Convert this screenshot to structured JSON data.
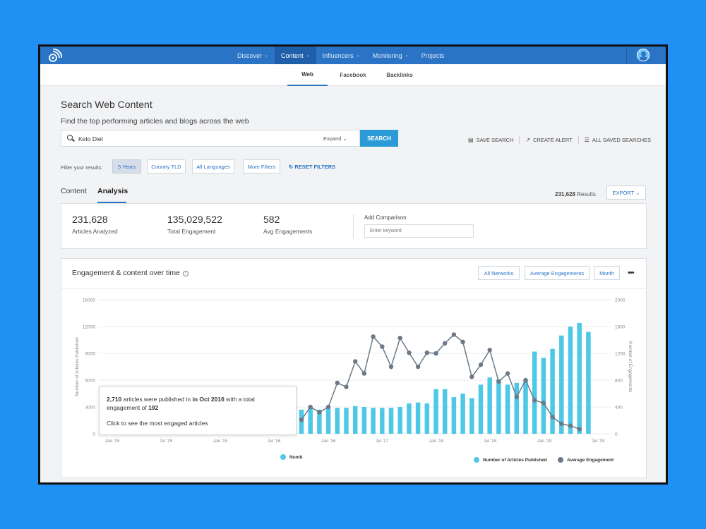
{
  "nav": {
    "items": [
      {
        "label": "Discover",
        "chev": true,
        "active": false
      },
      {
        "label": "Content",
        "chev": true,
        "active": true
      },
      {
        "label": "Influencers",
        "chev": true,
        "active": false
      },
      {
        "label": "Monitoring",
        "chev": true,
        "active": false
      },
      {
        "label": "Projects",
        "chev": false,
        "active": false
      }
    ]
  },
  "subnav": {
    "web": "Web",
    "facebook": "Facebook",
    "backlinks": "Backlinks"
  },
  "page": {
    "title": "Search Web Content",
    "subtitle": "Find the top performing articles and blogs across the web"
  },
  "search": {
    "value": "Keto Diet",
    "expand": "Expand",
    "button": "SEARCH",
    "save": "SAVE SEARCH",
    "alert": "CREATE ALERT",
    "saved": "ALL SAVED SEARCHES"
  },
  "filters": {
    "label": "Filter your results:",
    "years": "5 Years",
    "tld": "Country TLD",
    "languages": "All Languages",
    "more": "More Filters",
    "reset": "RESET FILTERS"
  },
  "tabs": {
    "content": "Content",
    "analysis": "Analysis"
  },
  "results": {
    "count": "231,628",
    "label": "Results",
    "export": "EXPORT"
  },
  "stats": {
    "articles_value": "231,628",
    "articles_label": "Articles Analyzed",
    "engagement_value": "135,029,522",
    "engagement_label": "Total Engagement",
    "avg_value": "582",
    "avg_label": "Avg Engagements",
    "compare_label": "Add Comparison",
    "compare_placeholder": "Enter keyword"
  },
  "chart_card": {
    "title": "Engagement & content over time",
    "networks": "All Networks",
    "metric": "Average Engagements",
    "period": "Month",
    "more": "•••"
  },
  "tooltip": {
    "count": "2,710",
    "text1": " articles were published in ",
    "month": "in Oct 2016",
    "text2": " with a total engagement of ",
    "engagement": "192",
    "cta": "Click to see the most engaged articles"
  },
  "legend": {
    "partial": "Numb",
    "articles": "Number of Articles Published",
    "engagement": "Average Engagement"
  },
  "colors": {
    "bar": "#4fc8e6",
    "line": "#6b7885",
    "accent": "#2b74c5",
    "button": "#2b9bd8"
  },
  "chart_data": {
    "type": "bar",
    "x_ticks": [
      "Jan '15",
      "Jul '15",
      "Jan '15",
      "Jul '16",
      "Jan '16",
      "Jul '17",
      "Jan '18",
      "Jul '18",
      "Jan '19",
      "Jul '19"
    ],
    "ylabel": "Number of Articles Published",
    "ylabel_right": "Number of Engagements",
    "ylim": [
      0,
      15000
    ],
    "ylim_right": [
      0,
      2000
    ],
    "yticks": [
      "0",
      "3000",
      "6000",
      "9000",
      "12000",
      "15000"
    ],
    "yticks_right": [
      "0",
      "400",
      "800",
      "1200",
      "1600",
      "2000"
    ],
    "series": [
      {
        "name": "Number of Articles Published",
        "type": "bar",
        "values": [
          2700,
          2900,
          2700,
          2800,
          2900,
          2900,
          3100,
          3000,
          2900,
          2900,
          2900,
          3000,
          3400,
          3500,
          3400,
          5000,
          5000,
          4100,
          4500,
          4000,
          5500,
          6300,
          6100,
          5500,
          5700,
          6000,
          9200,
          8500,
          9500,
          11000,
          12000,
          12400,
          11400
        ]
      },
      {
        "name": "Average Engagement",
        "type": "line",
        "values": [
          210,
          400,
          320,
          400,
          760,
          700,
          1080,
          900,
          1450,
          1300,
          1000,
          1430,
          1210,
          1000,
          1210,
          1200,
          1350,
          1480,
          1370,
          850,
          1030,
          1250,
          780,
          900,
          550,
          800,
          500,
          460,
          250,
          150,
          120,
          70
        ]
      }
    ],
    "grid": true,
    "legend": "bottom"
  }
}
